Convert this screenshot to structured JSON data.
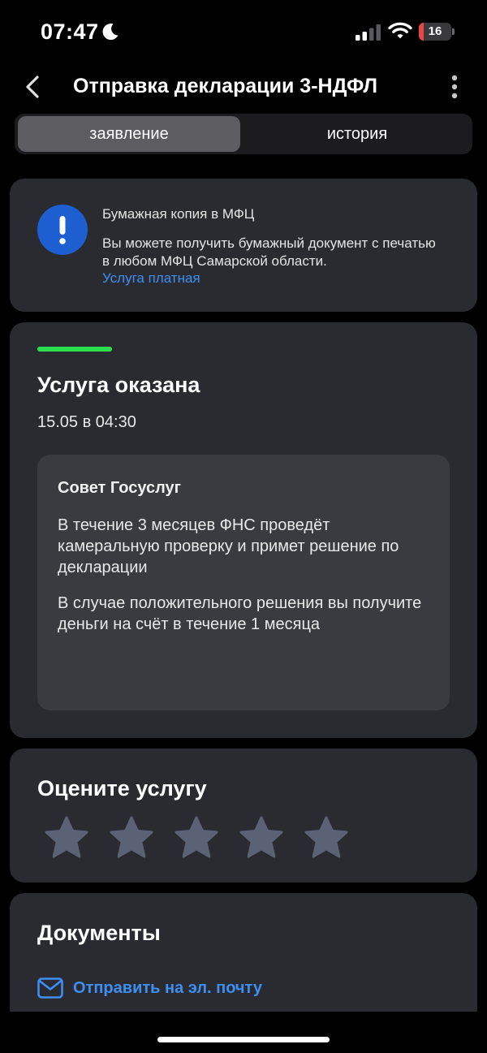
{
  "status_bar": {
    "time": "07:47",
    "battery_level": "16",
    "battery_fraction": 0.16,
    "moon_icon": "moon-icon",
    "signal_icon": "signal-icon",
    "wifi_icon": "wifi-icon"
  },
  "header": {
    "title": "Отправка декларации 3-НДФЛ",
    "back_icon": "chevron-left-icon",
    "more_icon": "more-vertical-icon"
  },
  "tabs": [
    {
      "label": "заявление",
      "active": true
    },
    {
      "label": "история",
      "active": false
    }
  ],
  "mfc_notice": {
    "icon": "exclamation-icon",
    "title": "Бумажная копия в МФЦ",
    "text": "Вы можете получить бумажный документ с печатью в любом МФЦ Самарской области.",
    "link": "Услуга платная"
  },
  "status_card": {
    "progress": 1.0,
    "title": "Услуга оказана",
    "date": "15.05 в 04:30",
    "advice": {
      "title": "Совет Госуслуг",
      "paragraph1": "В течение 3 месяцев ФНС проведёт камеральную проверку и примет решение по декларации",
      "paragraph2": "В случае положительного решения вы получите деньги на счёт в течение 1 месяца"
    }
  },
  "rating": {
    "title": "Оцените услугу",
    "stars_total": 5,
    "stars_selected": 0
  },
  "documents": {
    "title": "Документы",
    "email_icon": "mail-icon",
    "email_link": "Отправить на эл. почту"
  },
  "colors": {
    "background": "#000000",
    "card": "#2a2b30",
    "inner_card": "#3a3b41",
    "accent_blue": "#3d8ff3",
    "success_green": "#2ee04f",
    "star_gray": "#5c6275",
    "alert_blue": "#1d5fd0"
  }
}
